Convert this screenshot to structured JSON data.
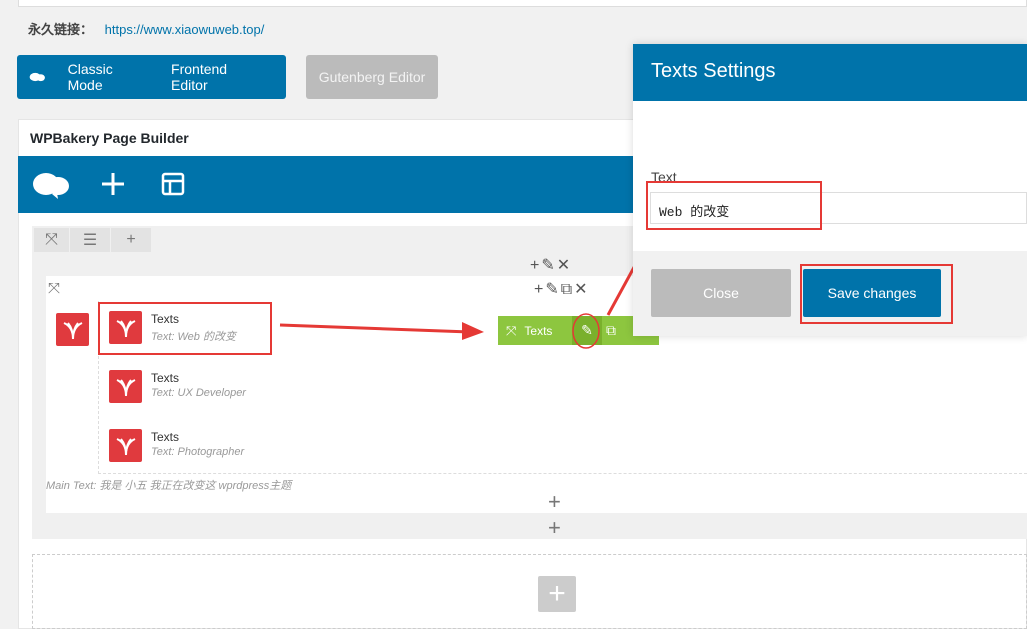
{
  "permalink": {
    "label": "永久链接：",
    "url": "https://www.xiaowuweb.top/"
  },
  "mode_buttons": {
    "classic": "Classic Mode",
    "frontend": "Frontend Editor",
    "gutenberg": "Gutenberg Editor"
  },
  "builder": {
    "title": "WPBakery Page Builder"
  },
  "elements": [
    {
      "name": "Texts",
      "sub": "Text: Web 的改变"
    },
    {
      "name": "Texts",
      "sub": "Text: UX Developer"
    },
    {
      "name": "Texts",
      "sub": "Text: Photographer"
    }
  ],
  "main_text": "Main Text: 我是 小五 我正在改变这 wprdpress主题",
  "element_toolbar": {
    "label": "Texts"
  },
  "modal": {
    "title": "Texts Settings",
    "field_label": "Text",
    "field_value": "Web 的改变",
    "close": "Close",
    "save": "Save changes"
  },
  "colors": {
    "brand": "#0073aa",
    "accent_green": "#8dc63f",
    "highlight": "#e53935"
  }
}
